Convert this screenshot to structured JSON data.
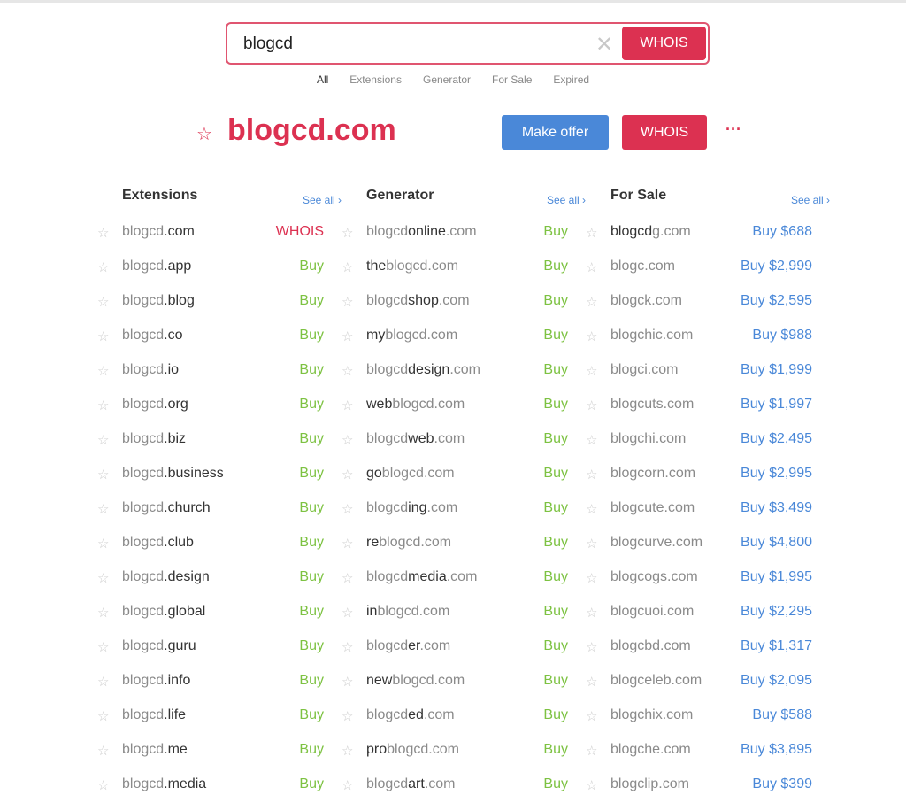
{
  "search": {
    "value": "blogcd",
    "button": "WHOIS",
    "clear_icon": "close-icon"
  },
  "tabs": [
    "All",
    "Extensions",
    "Generator",
    "For Sale",
    "Expired"
  ],
  "hero": {
    "domain": "blogcd.com",
    "make_offer": "Make offer",
    "whois": "WHOIS",
    "more": "···"
  },
  "colors": {
    "accent": "#dc3151",
    "blue": "#4a88d8",
    "green": "#7dc242"
  },
  "columns": [
    {
      "title": "Extensions",
      "see_all": "See all ›",
      "rows": [
        {
          "parts": [
            "blogcd",
            ".com",
            ""
          ],
          "action": "WHOIS",
          "type": "whois"
        },
        {
          "parts": [
            "blogcd",
            ".app",
            ""
          ],
          "action": "Buy",
          "type": "buy"
        },
        {
          "parts": [
            "blogcd",
            ".blog",
            ""
          ],
          "action": "Buy",
          "type": "buy"
        },
        {
          "parts": [
            "blogcd",
            ".co",
            ""
          ],
          "action": "Buy",
          "type": "buy"
        },
        {
          "parts": [
            "blogcd",
            ".io",
            ""
          ],
          "action": "Buy",
          "type": "buy"
        },
        {
          "parts": [
            "blogcd",
            ".org",
            ""
          ],
          "action": "Buy",
          "type": "buy"
        },
        {
          "parts": [
            "blogcd",
            ".biz",
            ""
          ],
          "action": "Buy",
          "type": "buy"
        },
        {
          "parts": [
            "blogcd",
            ".business",
            ""
          ],
          "action": "Buy",
          "type": "buy"
        },
        {
          "parts": [
            "blogcd",
            ".church",
            ""
          ],
          "action": "Buy",
          "type": "buy"
        },
        {
          "parts": [
            "blogcd",
            ".club",
            ""
          ],
          "action": "Buy",
          "type": "buy"
        },
        {
          "parts": [
            "blogcd",
            ".design",
            ""
          ],
          "action": "Buy",
          "type": "buy"
        },
        {
          "parts": [
            "blogcd",
            ".global",
            ""
          ],
          "action": "Buy",
          "type": "buy"
        },
        {
          "parts": [
            "blogcd",
            ".guru",
            ""
          ],
          "action": "Buy",
          "type": "buy"
        },
        {
          "parts": [
            "blogcd",
            ".info",
            ""
          ],
          "action": "Buy",
          "type": "buy"
        },
        {
          "parts": [
            "blogcd",
            ".life",
            ""
          ],
          "action": "Buy",
          "type": "buy"
        },
        {
          "parts": [
            "blogcd",
            ".me",
            ""
          ],
          "action": "Buy",
          "type": "buy"
        },
        {
          "parts": [
            "blogcd",
            ".media",
            ""
          ],
          "action": "Buy",
          "type": "buy"
        }
      ]
    },
    {
      "title": "Generator",
      "see_all": "See all ›",
      "rows": [
        {
          "parts": [
            "blogcd",
            "online",
            ".com"
          ],
          "action": "Buy",
          "type": "buy"
        },
        {
          "parts": [
            "",
            "the",
            "blogcd.com"
          ],
          "action": "Buy",
          "type": "buy"
        },
        {
          "parts": [
            "blogcd",
            "shop",
            ".com"
          ],
          "action": "Buy",
          "type": "buy"
        },
        {
          "parts": [
            "",
            "my",
            "blogcd.com"
          ],
          "action": "Buy",
          "type": "buy"
        },
        {
          "parts": [
            "blogcd",
            "design",
            ".com"
          ],
          "action": "Buy",
          "type": "buy"
        },
        {
          "parts": [
            "",
            "web",
            "blogcd.com"
          ],
          "action": "Buy",
          "type": "buy"
        },
        {
          "parts": [
            "blogcd",
            "web",
            ".com"
          ],
          "action": "Buy",
          "type": "buy"
        },
        {
          "parts": [
            "",
            "go",
            "blogcd.com"
          ],
          "action": "Buy",
          "type": "buy"
        },
        {
          "parts": [
            "blogcd",
            "ing",
            ".com"
          ],
          "action": "Buy",
          "type": "buy"
        },
        {
          "parts": [
            "",
            "re",
            "blogcd.com"
          ],
          "action": "Buy",
          "type": "buy"
        },
        {
          "parts": [
            "blogcd",
            "media",
            ".com"
          ],
          "action": "Buy",
          "type": "buy"
        },
        {
          "parts": [
            "",
            "in",
            "blogcd.com"
          ],
          "action": "Buy",
          "type": "buy"
        },
        {
          "parts": [
            "blogcd",
            "er",
            ".com"
          ],
          "action": "Buy",
          "type": "buy"
        },
        {
          "parts": [
            "",
            "new",
            "blogcd.com"
          ],
          "action": "Buy",
          "type": "buy"
        },
        {
          "parts": [
            "blogcd",
            "ed",
            ".com"
          ],
          "action": "Buy",
          "type": "buy"
        },
        {
          "parts": [
            "",
            "pro",
            "blogcd.com"
          ],
          "action": "Buy",
          "type": "buy"
        },
        {
          "parts": [
            "blogcd",
            "art",
            ".com"
          ],
          "action": "Buy",
          "type": "buy"
        }
      ]
    },
    {
      "title": "For Sale",
      "see_all": "See all ›",
      "rows": [
        {
          "parts": [
            "",
            "blogcd",
            "g.com"
          ],
          "action": "Buy $688",
          "type": "price"
        },
        {
          "parts": [
            "blogc.com",
            "",
            ""
          ],
          "action": "Buy $2,999",
          "type": "price"
        },
        {
          "parts": [
            "blogck.com",
            "",
            ""
          ],
          "action": "Buy $2,595",
          "type": "price"
        },
        {
          "parts": [
            "blogchic.com",
            "",
            ""
          ],
          "action": "Buy $988",
          "type": "price"
        },
        {
          "parts": [
            "blogci.com",
            "",
            ""
          ],
          "action": "Buy $1,999",
          "type": "price"
        },
        {
          "parts": [
            "blogcuts.com",
            "",
            ""
          ],
          "action": "Buy $1,997",
          "type": "price"
        },
        {
          "parts": [
            "blogchi.com",
            "",
            ""
          ],
          "action": "Buy $2,495",
          "type": "price"
        },
        {
          "parts": [
            "blogcorn.com",
            "",
            ""
          ],
          "action": "Buy $2,995",
          "type": "price"
        },
        {
          "parts": [
            "blogcute.com",
            "",
            ""
          ],
          "action": "Buy $3,499",
          "type": "price"
        },
        {
          "parts": [
            "blogcurve.com",
            "",
            ""
          ],
          "action": "Buy $4,800",
          "type": "price"
        },
        {
          "parts": [
            "blogcogs.com",
            "",
            ""
          ],
          "action": "Buy $1,995",
          "type": "price"
        },
        {
          "parts": [
            "blogcuoi.com",
            "",
            ""
          ],
          "action": "Buy $2,295",
          "type": "price"
        },
        {
          "parts": [
            "blogcbd.com",
            "",
            ""
          ],
          "action": "Buy $1,317",
          "type": "price"
        },
        {
          "parts": [
            "blogceleb.com",
            "",
            ""
          ],
          "action": "Buy $2,095",
          "type": "price"
        },
        {
          "parts": [
            "blogchix.com",
            "",
            ""
          ],
          "action": "Buy $588",
          "type": "price"
        },
        {
          "parts": [
            "blogche.com",
            "",
            ""
          ],
          "action": "Buy $3,895",
          "type": "price"
        },
        {
          "parts": [
            "blogclip.com",
            "",
            ""
          ],
          "action": "Buy $399",
          "type": "price"
        }
      ]
    }
  ]
}
